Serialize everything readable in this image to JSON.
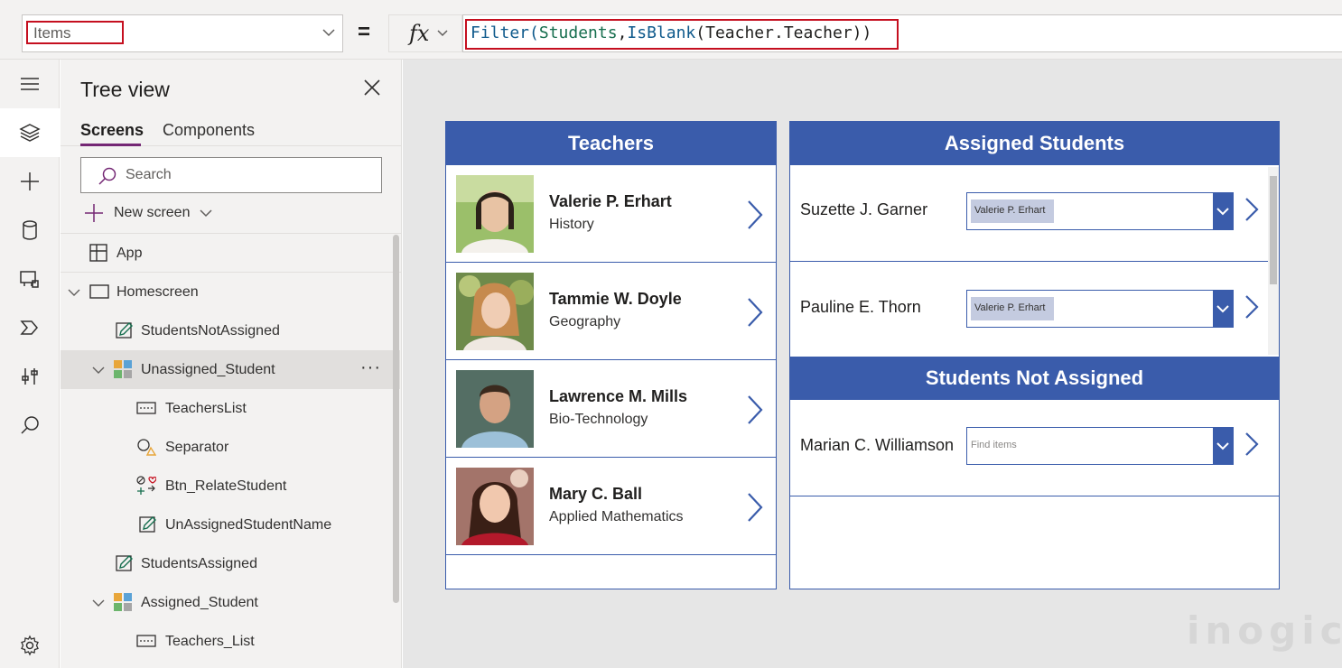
{
  "formula_bar": {
    "property": "Items",
    "fx_label": "fx",
    "equals": "=",
    "formula": {
      "p1": "Filter(",
      "p2": "Students",
      "p3": ",",
      "p4": "IsBlank",
      "p5": "(",
      "p6": "Teacher",
      "p7": ".",
      "p8": "Teacher",
      "p9": "))"
    }
  },
  "tree": {
    "title": "Tree view",
    "tabs": [
      "Screens",
      "Components"
    ],
    "search_placeholder": "Search",
    "new_screen": "New screen",
    "nodes": [
      "App",
      "Homescreen",
      "StudentsNotAssigned",
      "Unassigned_Student",
      "TeachersList",
      "Separator",
      "Btn_RelateStudent",
      "UnAssignedStudentName",
      "StudentsAssigned",
      "Assigned_Student",
      "Teachers_List"
    ],
    "more": "···"
  },
  "canvas": {
    "teachers_header": "Teachers",
    "teachers": [
      {
        "name": "Valerie P. Erhart",
        "subject": "History"
      },
      {
        "name": "Tammie W. Doyle",
        "subject": "Geography"
      },
      {
        "name": "Lawrence M. Mills",
        "subject": "Bio-Technology"
      },
      {
        "name": "Mary C. Ball",
        "subject": "Applied Mathematics"
      }
    ],
    "assigned_header": "Assigned Students",
    "assigned": [
      {
        "name": "Suzette J. Garner",
        "teacher": "Valerie P. Erhart"
      },
      {
        "name": "Pauline E. Thorn",
        "teacher": "Valerie P. Erhart"
      }
    ],
    "not_assigned_header": "Students Not Assigned",
    "not_assigned": [
      {
        "name": "Marian C. Williamson",
        "placeholder": "Find items"
      }
    ]
  },
  "watermark": "inogic",
  "colors": {
    "accent": "#3a5cab",
    "highlight": "#c50f1f",
    "brand": "#742774"
  }
}
